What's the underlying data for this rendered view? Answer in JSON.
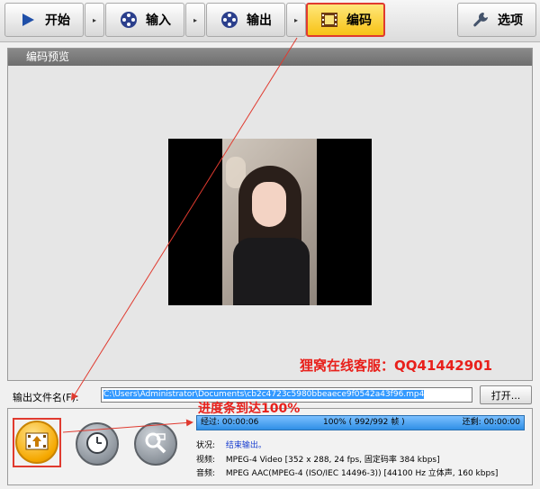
{
  "toolbar": {
    "start_label": "开始",
    "input_label": "输入",
    "output_label": "输出",
    "encode_label": "编码",
    "options_label": "选项",
    "separator_glyph": "▸",
    "active_tab": "编码",
    "highlight_color": "#e03a2f"
  },
  "preview": {
    "title": "编码预览"
  },
  "annotations": {
    "promo": "狸窝在线客服：QQ41442901",
    "progress_note": "进度条到达100%"
  },
  "output": {
    "label": "输出文件名(F):",
    "filename": "C:\\Users\\Administrator\\Documents\\cb2c4723c5980bbeaece9f0542a43f96.mp4",
    "open_button": "打开..."
  },
  "progress": {
    "percent": 100,
    "elapsed": "经过: 00:00:06",
    "frames": "100% ( 992/992 帧 )",
    "remaining": "还剩: 00:00:00"
  },
  "info": {
    "status_label": "状况:",
    "status_value": "结束输出。",
    "video_label": "视频:",
    "video_value": "MPEG-4 Video [352 x 288, 24 fps, 固定码率 384 kbps]",
    "audio_label": "音频:",
    "audio_value": "MPEG AAC(MPEG-4 (ISO/IEC 14496-3)) [44100 Hz 立体声, 160 kbps]"
  },
  "icons": {
    "start": "play-icon",
    "input": "film-reel-icon",
    "output": "film-reel-icon",
    "encode": "film-strip-icon",
    "options": "wrench-icon",
    "encode_button": "film-upload-icon",
    "schedule_button": "clock-icon",
    "search_button": "magnifier-icon"
  },
  "colors": {
    "accent": "#f7c215",
    "annotation_red": "#e8201b",
    "progress_blue": "#2f8fe6",
    "status_blue": "#1a3fd0"
  }
}
